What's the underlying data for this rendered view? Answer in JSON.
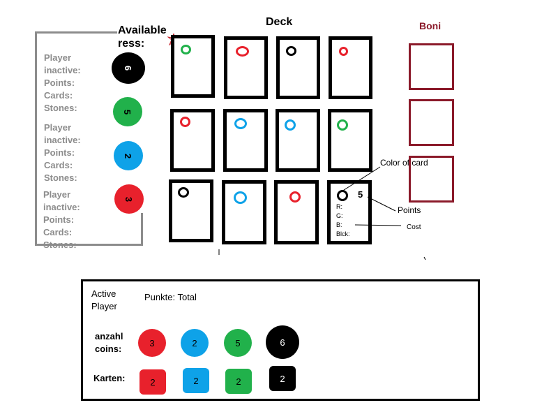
{
  "colors": {
    "red": "#e8212c",
    "blue": "#0ea2e8",
    "green": "#21b14b",
    "black": "#000000",
    "grey": "#8c8c8c",
    "boni": "#8b1a2a"
  },
  "inactive_players": [
    {
      "player": "Player",
      "status": "inactive:",
      "points": "Points:",
      "cards": "Cards:",
      "stones": "Stones:"
    },
    {
      "player": "Player",
      "status": "inactive:",
      "points": "Points:",
      "cards": "Cards:",
      "stones": "Stones:"
    },
    {
      "player": "Player",
      "status": "inactive:",
      "points": "Points:",
      "cards": "Cards:",
      "stones": "Stones:"
    }
  ],
  "available_resources": {
    "title_line1": "Available",
    "title_line2": "ress:",
    "coins": [
      {
        "color": "black",
        "value": "6"
      },
      {
        "color": "green",
        "value": "5"
      },
      {
        "color": "blue",
        "value": "2"
      },
      {
        "color": "red",
        "value": "3"
      }
    ]
  },
  "deck": {
    "title": "Deck",
    "rows": [
      [
        "green",
        "red",
        "black",
        "red"
      ],
      [
        "red",
        "blue",
        "blue",
        "green"
      ],
      [
        "black",
        "blue",
        "red",
        "black"
      ]
    ]
  },
  "example_card": {
    "points": "5",
    "cost_lines": [
      "R:",
      "G:",
      "B:",
      "Blck:"
    ]
  },
  "annotations": {
    "color_of_card": "Color of card",
    "points": "Points",
    "cost": "Cost"
  },
  "boni": {
    "title": "Boni",
    "slots": 3
  },
  "active_player": {
    "label_line1": "Active",
    "label_line2": "Player",
    "punkte": "Punkte: Total",
    "coins_label_line1": "anzahl",
    "coins_label_line2": "coins:",
    "cards_label": "Karten:",
    "coins": [
      {
        "color": "red",
        "value": "3"
      },
      {
        "color": "blue",
        "value": "2"
      },
      {
        "color": "green",
        "value": "5"
      },
      {
        "color": "black",
        "value": "6"
      }
    ],
    "cards": [
      {
        "color": "red",
        "value": "2"
      },
      {
        "color": "blue",
        "value": "2"
      },
      {
        "color": "green",
        "value": "2"
      },
      {
        "color": "black",
        "value": "2"
      }
    ]
  }
}
